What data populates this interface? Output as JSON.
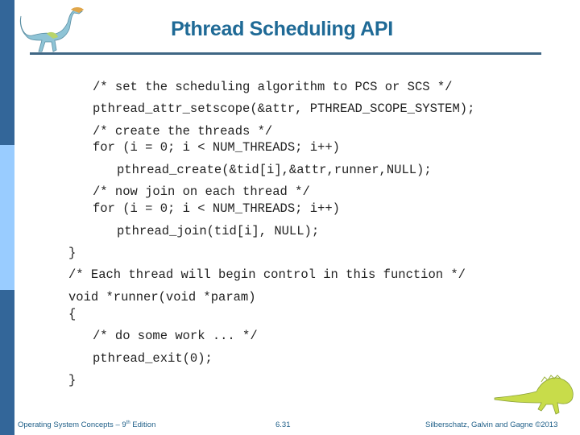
{
  "slide": {
    "title": "Pthread Scheduling API",
    "code_lines": [
      "/* set the scheduling algorithm to PCS or SCS */",
      "pthread_attr_setscope(&attr, PTHREAD_SCOPE_SYSTEM);",
      "/* create the threads */",
      "for (i = 0; i < NUM_THREADS; i++)",
      "pthread_create(&tid[i],&attr,runner,NULL);",
      "/* now join on each thread */",
      "for (i = 0; i < NUM_THREADS; i++)",
      "pthread_join(tid[i], NULL);",
      "}",
      "/* Each thread will begin control in this function */",
      "void *runner(void *param)",
      "{",
      "/* do some work ... */",
      "pthread_exit(0);",
      "}"
    ]
  },
  "footer": {
    "book_prefix": "Operating System Concepts – 9",
    "book_sup": "th",
    "book_suffix": " Edition",
    "page_number": "6.31",
    "copyright": "Silberschatz, Galvin and Gagne ©2013"
  },
  "icons": {
    "top_left": "dinosaur-icon",
    "bottom_right": "dinosaur-icon"
  },
  "colors": {
    "sidebar_dark": "#336699",
    "sidebar_light": "#99ccff",
    "title": "#1f6a96",
    "rule": "#3f6684"
  }
}
